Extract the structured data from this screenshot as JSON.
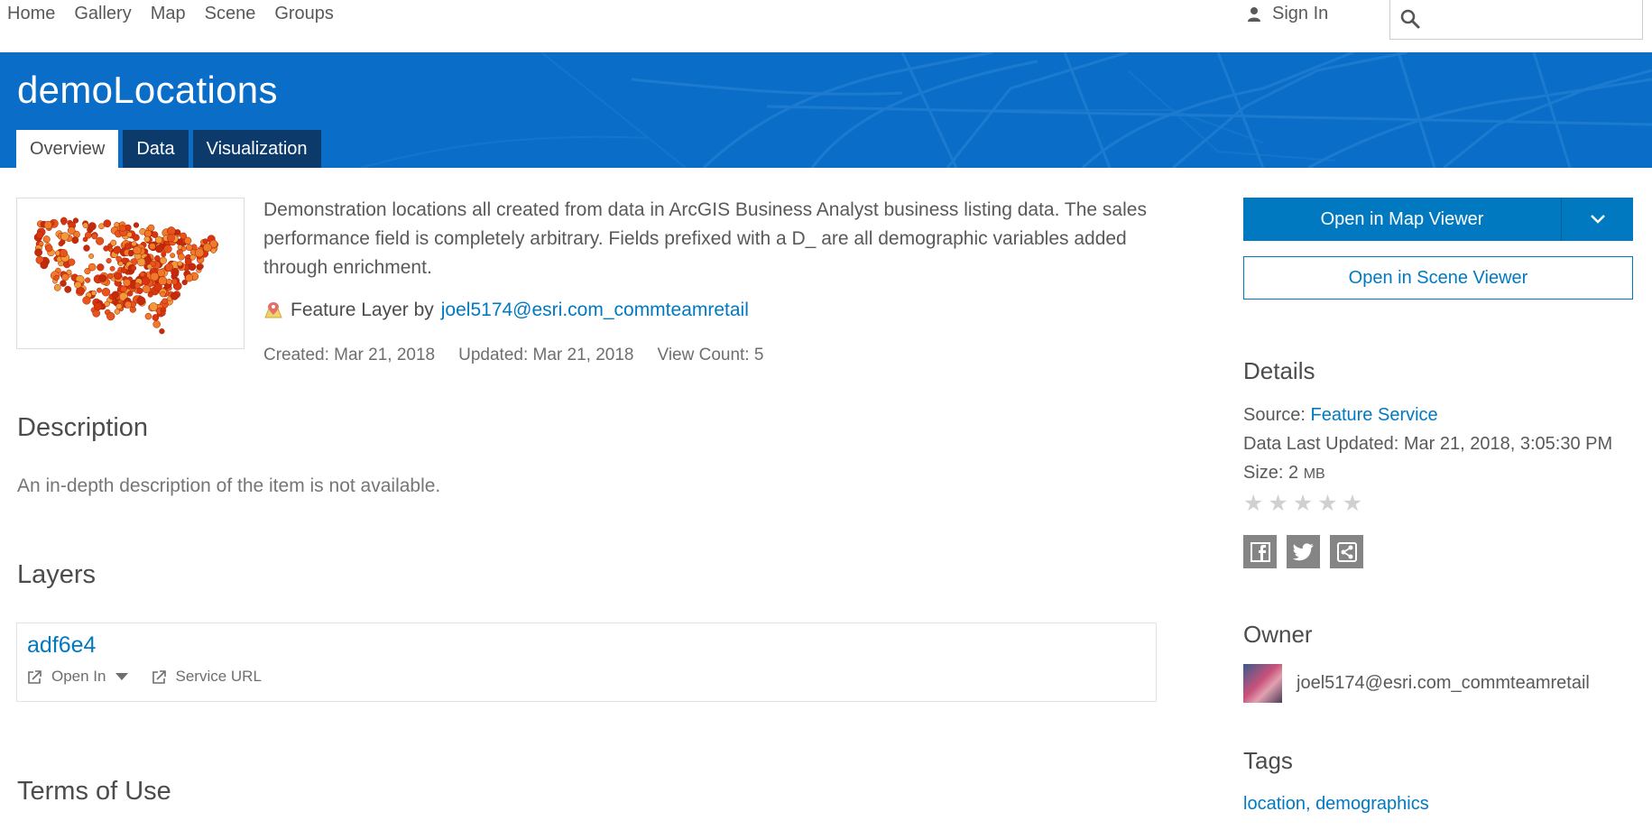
{
  "nav": {
    "items": [
      "Home",
      "Gallery",
      "Map",
      "Scene",
      "Groups"
    ],
    "signin": "Sign In"
  },
  "item": {
    "title": "demoLocations",
    "tabs": [
      "Overview",
      "Data",
      "Visualization"
    ],
    "summary": "Demonstration locations all created from data in ArcGIS Business Analyst business listing data. The sales performance field is completely arbitrary. Fields prefixed with a D_ are all demographic variables added through enrichment.",
    "type_label": "Feature Layer by",
    "owner": "joel5174@esri.com_commteamretail",
    "created": "Created: Mar 21, 2018",
    "updated": "Updated: Mar 21, 2018",
    "view_count": "View Count: 5"
  },
  "description": {
    "heading": "Description",
    "text": "An in-depth description of the item is not available."
  },
  "layers": {
    "heading": "Layers",
    "name": "adf6e4",
    "open_in": "Open In",
    "service_url": "Service URL"
  },
  "terms": {
    "heading": "Terms of Use"
  },
  "actions": {
    "open_map_viewer": "Open in Map Viewer",
    "open_scene_viewer": "Open in Scene Viewer"
  },
  "details": {
    "heading": "Details",
    "source_label": "Source:",
    "source_value": "Feature Service",
    "last_updated": "Data Last Updated: Mar 21, 2018, 3:05:30 PM",
    "size_label": "Size: 2",
    "size_unit": "MB",
    "rating_stars": 0
  },
  "owner_section": {
    "heading": "Owner",
    "name": "joel5174@esri.com_commteamretail"
  },
  "tags": {
    "heading": "Tags",
    "items": [
      "location",
      "demographics"
    ]
  },
  "colors": {
    "brand_blue": "#0079c1",
    "banner_blue": "#0a6ec8",
    "tab_dark": "#0b3a6b"
  },
  "icons": [
    "user-icon",
    "search-icon",
    "feature-layer-icon",
    "external-link-icon",
    "caret-down-icon",
    "chevron-down-icon",
    "star-icon",
    "facebook-icon",
    "twitter-icon",
    "share-icon"
  ]
}
